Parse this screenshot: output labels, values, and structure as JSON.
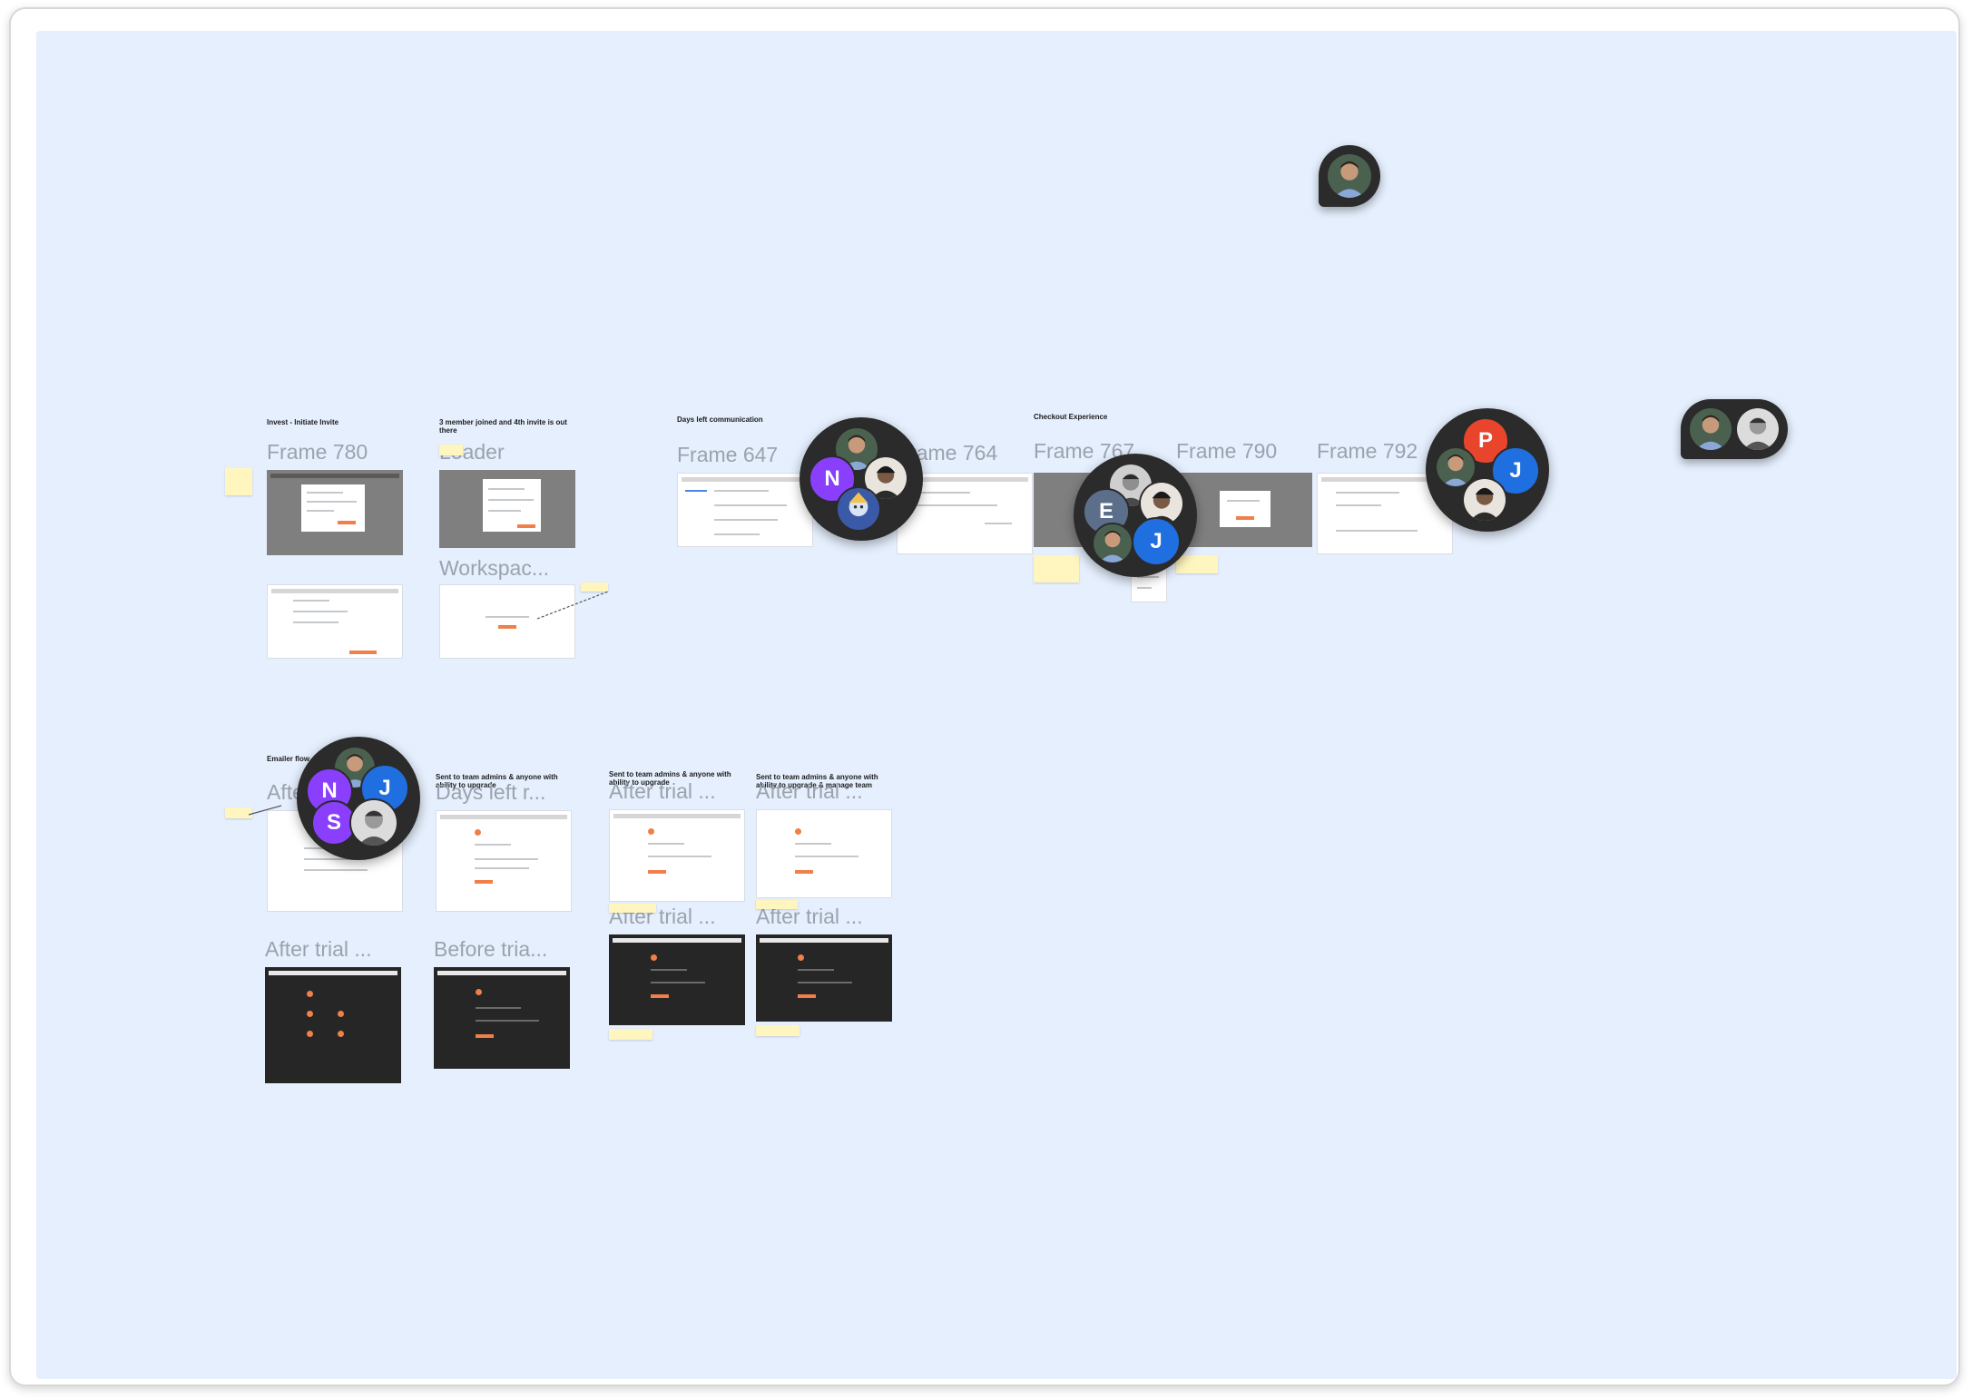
{
  "colors": {
    "canvas_bg": "#e5effd",
    "avatar_purple": "#8a3ffc",
    "avatar_blue": "#1f6fe0",
    "avatar_red": "#e8452c",
    "avatar_slate": "#5b6f8a",
    "accent_orange": "#f07f4a",
    "cluster_bg": "#2b2b2b"
  },
  "sections": {
    "s1": "Invest - Initiate Invite",
    "s2": "3 member joined and 4th invite is out there",
    "s3": "Days left communication",
    "s4": "Checkout Experience",
    "s5": "Emailer flow",
    "s6": "Sent to team admins & anyone with ability to upgrade",
    "s7": "Sent to team admins & anyone with ability to upgrade",
    "s8": "Sent to team admins & anyone with ability to upgrade & manage team"
  },
  "frame_labels": {
    "f780": "Frame 780",
    "loader": "Loader",
    "workspace": "Workspac...",
    "f647": "Frame 647",
    "f764": "Frame 764",
    "f767": "Frame 767",
    "f790": "Frame 790",
    "f792": "Frame 792",
    "after1": "After ...",
    "days_left": "Days left r...",
    "after_trial_a": "After trial ...",
    "after_trial_b": "After trial ...",
    "after_trial_c": "After trial ...",
    "after_trial_d": "After trial ...",
    "after_trial_e": "After trial ...",
    "before_trial": "Before tria..."
  },
  "clusters": {
    "c1": {
      "letters": [
        "N"
      ],
      "icons": [
        "user-photo-icon",
        "user-photo-icon",
        "user-illustration-icon"
      ]
    },
    "c2": {
      "letters": [
        "E",
        "J"
      ],
      "icons": [
        "user-photo-icon",
        "user-photo-icon",
        "user-photo-icon"
      ]
    },
    "c3": {
      "letters": [
        "P",
        "J"
      ],
      "icons": [
        "user-photo-icon",
        "user-photo-icon"
      ]
    },
    "c4": {
      "letters": [
        "N",
        "J",
        "S"
      ],
      "icons": [
        "user-photo-icon",
        "user-photo-icon"
      ]
    }
  }
}
